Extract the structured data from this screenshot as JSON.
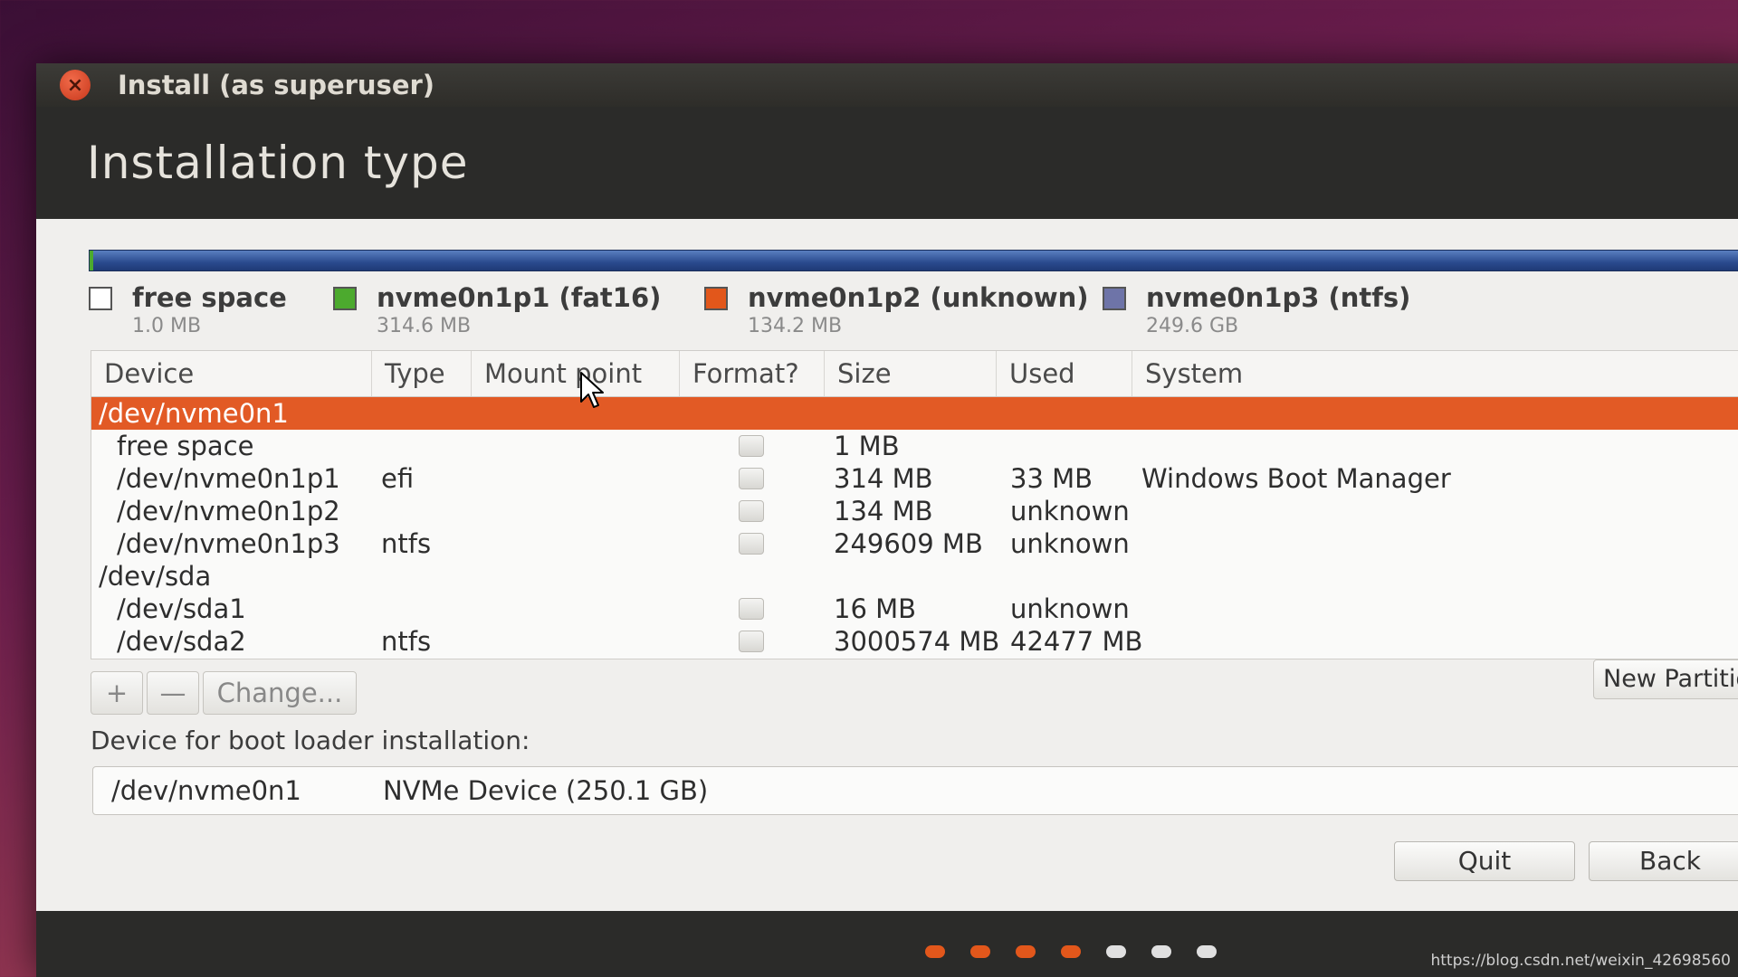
{
  "window": {
    "title": "Install (as superuser)"
  },
  "header": {
    "title": "Installation type"
  },
  "legend": [
    {
      "name": "free space",
      "size": "1.0 MB",
      "color": "#ffffff"
    },
    {
      "name": "nvme0n1p1 (fat16)",
      "size": "314.6 MB",
      "color": "#4caa2e"
    },
    {
      "name": "nvme0n1p2 (unknown)",
      "size": "134.2 MB",
      "color": "#e2571b"
    },
    {
      "name": "nvme0n1p3 (ntfs)",
      "size": "249.6 GB",
      "color": "#6e74a8"
    }
  ],
  "table": {
    "columns": [
      "Device",
      "Type",
      "Mount point",
      "Format?",
      "Size",
      "Used",
      "System"
    ],
    "rows": [
      {
        "device": "/dev/nvme0n1",
        "type": "",
        "mount": "",
        "format": false,
        "size": "",
        "used": "",
        "system": ""
      },
      {
        "device": "free space",
        "type": "",
        "mount": "",
        "format": false,
        "size": "1 MB",
        "used": "",
        "system": ""
      },
      {
        "device": "/dev/nvme0n1p1",
        "type": "efi",
        "mount": "",
        "format": false,
        "size": "314 MB",
        "used": "33 MB",
        "system": "Windows Boot Manager"
      },
      {
        "device": "/dev/nvme0n1p2",
        "type": "",
        "mount": "",
        "format": false,
        "size": "134 MB",
        "used": "unknown",
        "system": ""
      },
      {
        "device": "/dev/nvme0n1p3",
        "type": "ntfs",
        "mount": "",
        "format": false,
        "size": "249609 MB",
        "used": "unknown",
        "system": ""
      },
      {
        "device": "/dev/sda",
        "type": "",
        "mount": "",
        "format": false,
        "size": "",
        "used": "",
        "system": ""
      },
      {
        "device": "/dev/sda1",
        "type": "",
        "mount": "",
        "format": false,
        "size": "16 MB",
        "used": "unknown",
        "system": ""
      },
      {
        "device": "/dev/sda2",
        "type": "ntfs",
        "mount": "",
        "format": false,
        "size": "3000574 MB",
        "used": "42477 MB",
        "system": ""
      }
    ]
  },
  "toolbar": {
    "add": "+",
    "remove": "—",
    "change": "Change...",
    "new_partition": "New Partition"
  },
  "bootloader": {
    "label": "Device for boot loader installation:",
    "device": "/dev/nvme0n1",
    "description": "NVMe Device (250.1 GB)"
  },
  "buttons": {
    "quit": "Quit",
    "back": "Back"
  },
  "progress": {
    "total_steps": 7,
    "completed_steps": 4,
    "done_color": "#e2571b",
    "todo_color": "#e0e0e0"
  },
  "watermark": "https://blog.csdn.net/weixin_42698560"
}
